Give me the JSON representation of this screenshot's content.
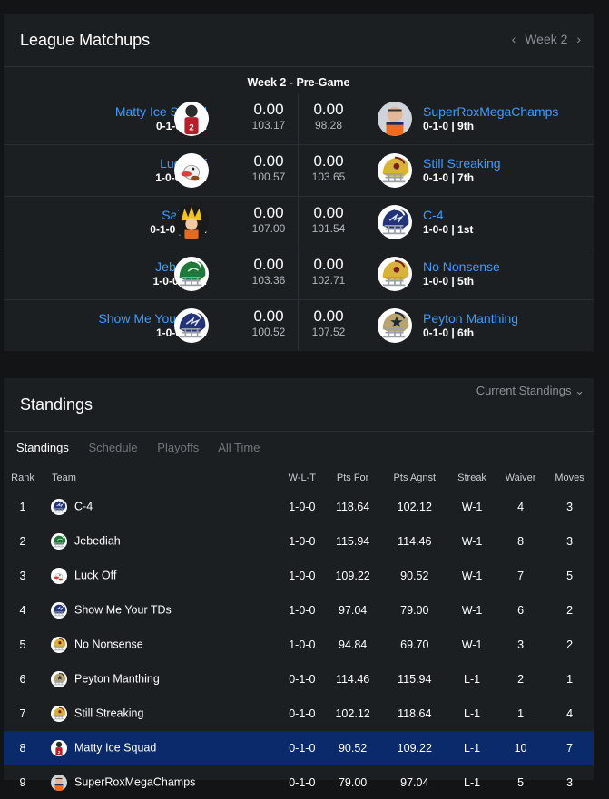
{
  "matchups": {
    "title": "League Matchups",
    "week_label": "Week 2",
    "prev_icon": "‹",
    "next_icon": "›",
    "heading": "Week 2 - Pre-Game",
    "games": [
      {
        "left": {
          "name": "Matty Ice Squad",
          "record": "0-1-0 | 8th",
          "score": "0.00",
          "proj": "103.17",
          "avatar": "falcons-player"
        },
        "right": {
          "name": "SuperRoxMegaChamps",
          "record": "0-1-0 | 9th",
          "score": "0.00",
          "proj": "98.28",
          "avatar": "broncos-qb"
        }
      },
      {
        "left": {
          "name": "Luck Off",
          "record": "1-0-0 | 3rd",
          "score": "0.00",
          "proj": "100.57",
          "avatar": "cartoon-duck"
        },
        "right": {
          "name": "Still Streaking",
          "record": "0-1-0 | 7th",
          "score": "0.00",
          "proj": "103.65",
          "avatar": "gold-helmet"
        }
      },
      {
        "left": {
          "name": "Saiyans",
          "record": "0-1-0 | 10th",
          "score": "0.00",
          "proj": "107.00",
          "avatar": "anime-hero"
        },
        "right": {
          "name": "C-4",
          "record": "1-0-0 | 1st",
          "score": "0.00",
          "proj": "101.54",
          "avatar": "navy-helmet"
        }
      },
      {
        "left": {
          "name": "Jebediah",
          "record": "1-0-0 | 2nd",
          "score": "0.00",
          "proj": "103.36",
          "avatar": "green-helmet"
        },
        "right": {
          "name": "No Nonsense",
          "record": "1-0-0 | 5th",
          "score": "0.00",
          "proj": "102.71",
          "avatar": "gold-helmet"
        }
      },
      {
        "left": {
          "name": "Show Me Your TDs",
          "record": "1-0-0 | 4th",
          "score": "0.00",
          "proj": "100.52",
          "avatar": "navy-helmet"
        },
        "right": {
          "name": "Peyton Manthing",
          "record": "0-1-0 | 6th",
          "score": "0.00",
          "proj": "107.52",
          "avatar": "star-helmet"
        }
      }
    ]
  },
  "standings": {
    "title": "Standings",
    "filter_label": "Current Standings",
    "filter_icon": "⌄",
    "tabs": [
      "Standings",
      "Schedule",
      "Playoffs",
      "All Time"
    ],
    "columns": [
      "Rank",
      "Team",
      "W-L-T",
      "Pts For",
      "Pts Agnst",
      "Streak",
      "Waiver",
      "Moves"
    ],
    "rows": [
      {
        "rank": "1",
        "team": "C-4",
        "wlt": "1-0-0",
        "pf": "118.64",
        "pa": "102.12",
        "streak": "W-1",
        "waiver": "4",
        "moves": "3",
        "avatar": "navy-helmet"
      },
      {
        "rank": "2",
        "team": "Jebediah",
        "wlt": "1-0-0",
        "pf": "115.94",
        "pa": "114.46",
        "streak": "W-1",
        "waiver": "8",
        "moves": "3",
        "avatar": "green-helmet"
      },
      {
        "rank": "3",
        "team": "Luck Off",
        "wlt": "1-0-0",
        "pf": "109.22",
        "pa": "90.52",
        "streak": "W-1",
        "waiver": "7",
        "moves": "5",
        "avatar": "cartoon-duck"
      },
      {
        "rank": "4",
        "team": "Show Me Your TDs",
        "wlt": "1-0-0",
        "pf": "97.04",
        "pa": "79.00",
        "streak": "W-1",
        "waiver": "6",
        "moves": "2",
        "avatar": "navy-helmet"
      },
      {
        "rank": "5",
        "team": "No Nonsense",
        "wlt": "1-0-0",
        "pf": "94.84",
        "pa": "69.70",
        "streak": "W-1",
        "waiver": "3",
        "moves": "2",
        "avatar": "gold-helmet"
      },
      {
        "rank": "6",
        "team": "Peyton Manthing",
        "wlt": "0-1-0",
        "pf": "114.46",
        "pa": "115.94",
        "streak": "L-1",
        "waiver": "2",
        "moves": "1",
        "avatar": "star-helmet"
      },
      {
        "rank": "7",
        "team": "Still Streaking",
        "wlt": "0-1-0",
        "pf": "102.12",
        "pa": "118.64",
        "streak": "L-1",
        "waiver": "1",
        "moves": "4",
        "avatar": "gold-helmet"
      },
      {
        "rank": "8",
        "team": "Matty Ice Squad",
        "wlt": "0-1-0",
        "pf": "90.52",
        "pa": "109.22",
        "streak": "L-1",
        "waiver": "10",
        "moves": "7",
        "avatar": "falcons-player",
        "highlighted": true
      },
      {
        "rank": "9",
        "team": "SuperRoxMegaChamps",
        "wlt": "0-1-0",
        "pf": "79.00",
        "pa": "97.04",
        "streak": "L-1",
        "waiver": "5",
        "moves": "3",
        "avatar": "broncos-qb"
      }
    ]
  },
  "colors": {
    "background": "#121416",
    "panel": "#1c1f22",
    "link": "#3d9bff",
    "highlight_row": "#0a2a6b"
  }
}
